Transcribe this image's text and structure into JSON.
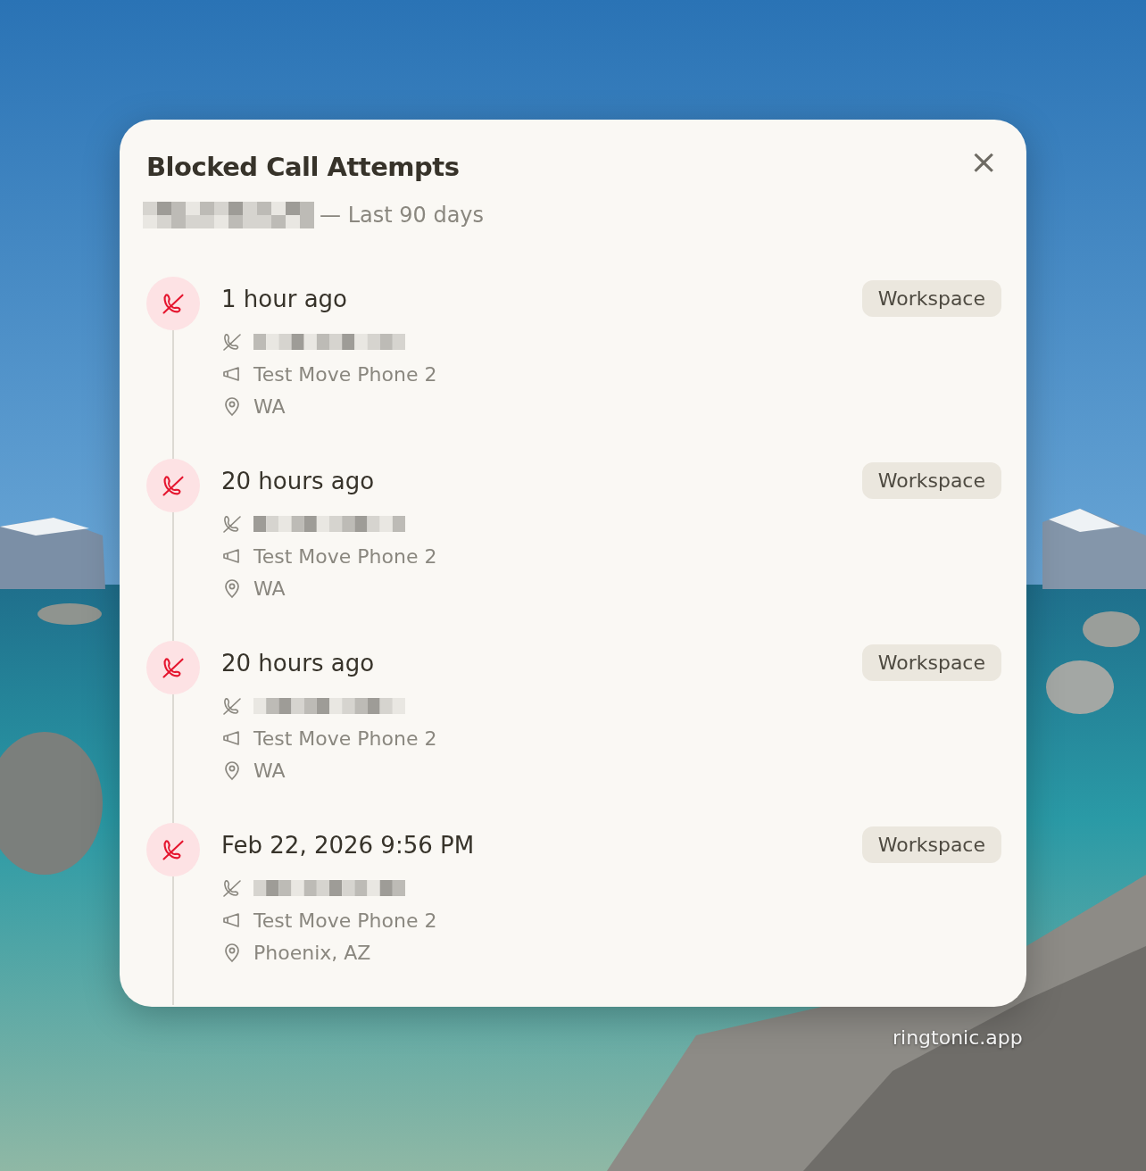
{
  "dialog": {
    "title": "Blocked Call Attempts",
    "subtitle": "— Last 90 days",
    "close_label": "×"
  },
  "attempts": [
    {
      "time": "1 hour ago",
      "badge": "Workspace",
      "line": "Test Move Phone 2",
      "location": "WA"
    },
    {
      "time": "20 hours ago",
      "badge": "Workspace",
      "line": "Test Move Phone 2",
      "location": "WA"
    },
    {
      "time": "20 hours ago",
      "badge": "Workspace",
      "line": "Test Move Phone 2",
      "location": "WA"
    },
    {
      "time": "Feb 22, 2026 9:56 PM",
      "badge": "Workspace",
      "line": "Test Move Phone 2",
      "location": "Phoenix, AZ"
    }
  ],
  "footer": "ringtonic.app"
}
